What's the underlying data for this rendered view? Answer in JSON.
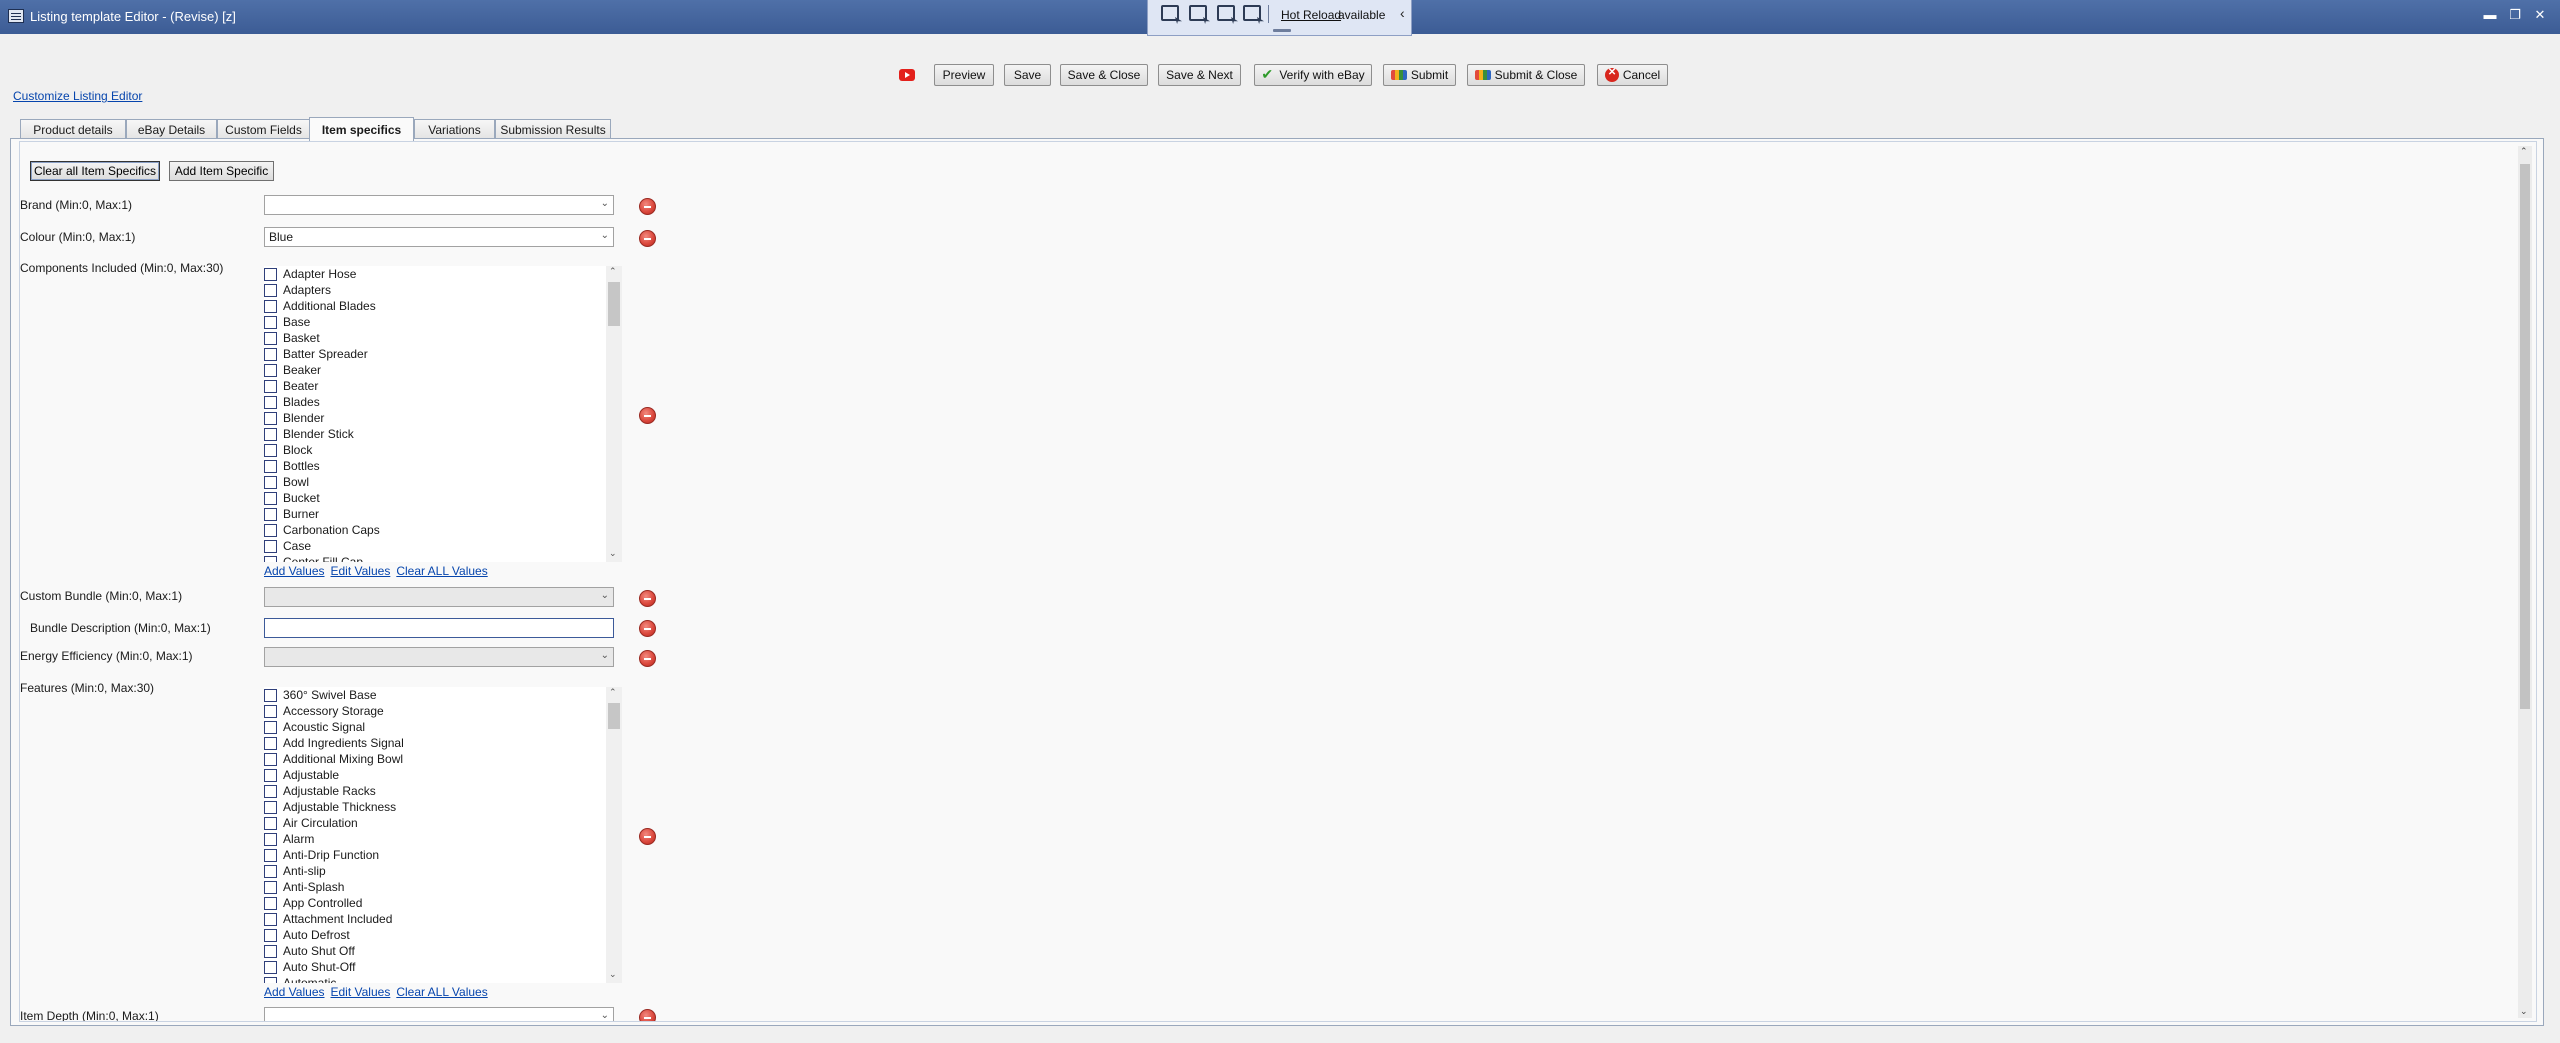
{
  "window": {
    "title": "Listing template Editor - (Revise) [z]",
    "controls": [
      "minimize",
      "restore",
      "close"
    ]
  },
  "hot_reload": {
    "link_label": "Hot Reload",
    "status_text": "available",
    "icons": [
      "select-element-icon",
      "pointer-icon",
      "display-layout-icon",
      "track-focus-icon"
    ]
  },
  "toolbar": {
    "preview": "Preview",
    "save": "Save",
    "save_close": "Save & Close",
    "save_next": "Save & Next",
    "verify": "Verify with eBay",
    "submit": "Submit",
    "submit_close": "Submit & Close",
    "cancel": "Cancel"
  },
  "customize_link": "Customize Listing Editor",
  "tabs": [
    {
      "label": "Product details",
      "active": false
    },
    {
      "label": "eBay Details",
      "active": false
    },
    {
      "label": "Custom Fields",
      "active": false
    },
    {
      "label": "Item specifics",
      "active": true
    },
    {
      "label": "Variations",
      "active": false
    },
    {
      "label": "Submission Results",
      "active": false
    }
  ],
  "item_specifics": {
    "clear_all_label": "Clear all Item Specifics",
    "add_label": "Add Item Specific",
    "brand": {
      "label": "Brand (Min:0, Max:1)",
      "value": ""
    },
    "colour": {
      "label": "Colour (Min:0, Max:1)",
      "value": "Blue"
    },
    "components": {
      "label": "Components Included (Min:0, Max:30)",
      "options": [
        "Adapter Hose",
        "Adapters",
        "Additional Blades",
        "Base",
        "Basket",
        "Batter Spreader",
        "Beaker",
        "Beater",
        "Blades",
        "Blender",
        "Blender Stick",
        "Block",
        "Bottles",
        "Bowl",
        "Bucket",
        "Burner",
        "Carbonation Caps",
        "Case",
        "Center Fill Cap"
      ]
    },
    "value_links": {
      "add": "Add Values",
      "edit": "Edit Values",
      "clear": "Clear ALL Values"
    },
    "custom_bundle": {
      "label": "Custom Bundle (Min:0, Max:1)",
      "value": ""
    },
    "bundle_description": {
      "label": "Bundle Description (Min:0, Max:1)",
      "value": ""
    },
    "energy_efficiency": {
      "label": "Energy Efficiency (Min:0, Max:1)",
      "value": ""
    },
    "features": {
      "label": "Features (Min:0, Max:30)",
      "options": [
        "360° Swivel Base",
        "Accessory Storage",
        "Acoustic Signal",
        "Add Ingredients Signal",
        "Additional Mixing Bowl",
        "Adjustable",
        "Adjustable Racks",
        "Adjustable Thickness",
        "Air Circulation",
        "Alarm",
        "Anti-Drip Function",
        "Anti-slip",
        "Anti-Splash",
        "App Controlled",
        "Attachment Included",
        "Auto Defrost",
        "Auto Shut Off",
        "Auto Shut-Off",
        "Automatic"
      ]
    },
    "item_depth": {
      "label": "Item Depth (Min:0, Max:1)",
      "value": ""
    }
  }
}
